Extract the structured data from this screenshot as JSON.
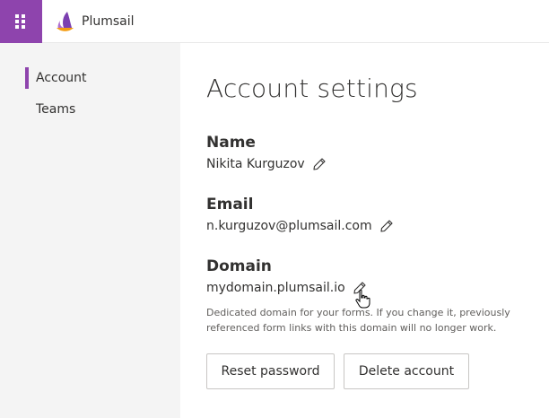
{
  "app": {
    "brand_name": "Plumsail",
    "accent_color": "#8e44ad"
  },
  "topbar": {
    "waffle_icon": "app-launcher-icon",
    "logo_icon": "plumsail-sail-logo"
  },
  "sidebar": {
    "items": [
      {
        "label": "Account",
        "active": true
      },
      {
        "label": "Teams",
        "active": false
      }
    ]
  },
  "main": {
    "title": "Account settings",
    "fields": [
      {
        "title": "Name",
        "value": "Nikita Kurguzov",
        "icon": "pencil-icon"
      },
      {
        "title": "Email",
        "value": "n.kurguzov@plumsail.com",
        "icon": "pencil-icon"
      },
      {
        "title": "Domain",
        "value": "mydomain.plumsail.io",
        "icon": "pencil-icon"
      }
    ],
    "domain_hint": "Dedicated domain for your forms. If you change it, previously referenced form links with this domain will no longer work.",
    "buttons": {
      "reset_password": "Reset password",
      "delete_account": "Delete account"
    }
  }
}
